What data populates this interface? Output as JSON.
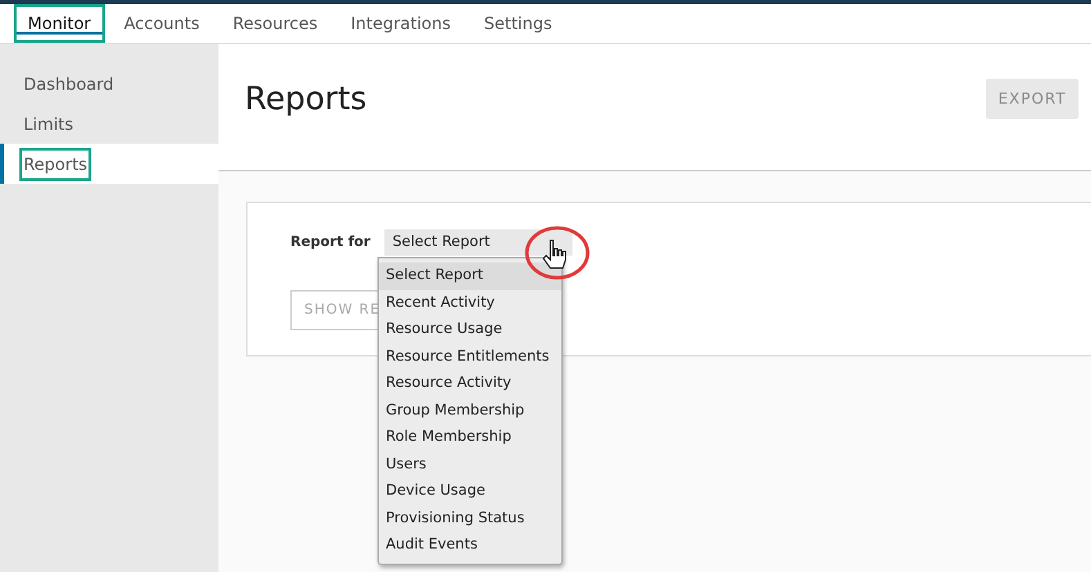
{
  "nav_tabs": [
    {
      "label": "Monitor",
      "selected": true,
      "highlighted": true
    },
    {
      "label": "Accounts",
      "selected": false,
      "highlighted": false
    },
    {
      "label": "Resources",
      "selected": false,
      "highlighted": false
    },
    {
      "label": "Integrations",
      "selected": false,
      "highlighted": false
    },
    {
      "label": "Settings",
      "selected": false,
      "highlighted": false
    }
  ],
  "sidebar": {
    "items": [
      {
        "label": "Dashboard",
        "selected": false,
        "highlighted": false
      },
      {
        "label": "Limits",
        "selected": false,
        "highlighted": false
      },
      {
        "label": "Reports",
        "selected": true,
        "highlighted": true
      }
    ]
  },
  "page_title": "Reports",
  "export_button": {
    "label": "EXPORT",
    "disabled": true
  },
  "report_form": {
    "label": "Report for",
    "select_value": "Select Report",
    "show_button": "SHOW RE",
    "options": [
      {
        "label": "Select Report",
        "selected": true
      },
      {
        "label": "Recent Activity",
        "selected": false
      },
      {
        "label": "Resource Usage",
        "selected": false
      },
      {
        "label": "Resource Entitlements",
        "selected": false
      },
      {
        "label": "Resource Activity",
        "selected": false
      },
      {
        "label": "Group Membership",
        "selected": false
      },
      {
        "label": "Role Membership",
        "selected": false
      },
      {
        "label": "Users",
        "selected": false
      },
      {
        "label": "Device Usage",
        "selected": false
      },
      {
        "label": "Provisioning Status",
        "selected": false
      },
      {
        "label": "Audit Events",
        "selected": false
      }
    ]
  }
}
